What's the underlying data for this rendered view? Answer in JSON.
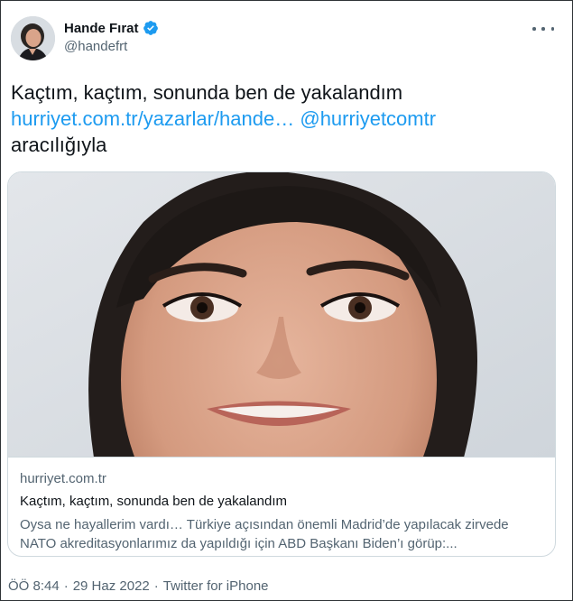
{
  "author": {
    "display_name": "Hande Fırat",
    "handle": "@handefrt",
    "verified": true,
    "avatar_icon": "profile-photo-icon"
  },
  "menu": {
    "icon": "more-dots-icon"
  },
  "tweet": {
    "text_main": "Kaçtım, kaçtım, sonunda ben de yakalandım",
    "link_url": "hurriyet.com.tr/yazarlar/hande…",
    "mention": "@hurriyetcomtr",
    "text_suffix": "aracılığıyla"
  },
  "link_card": {
    "image_icon": "article-photo",
    "domain": "hurriyet.com.tr",
    "title": "Kaçtım, kaçtım, sonunda ben de yakalandım",
    "description": "Oysa ne hayallerim vardı… Türkiye açısından önemli Madrid’de yapılacak zirvede NATO akreditasyonlarımız da yapıldığı için ABD Başkanı Biden’ı görüp:..."
  },
  "footer": {
    "time": "ÖÖ 8:44",
    "separator": "·",
    "date": "29 Haz 2022",
    "separator2": "·",
    "source": "Twitter for iPhone"
  },
  "colors": {
    "link": "#1d9bf0",
    "text": "#0f1419",
    "secondary": "#536471",
    "verified_badge": "#1d9bf0",
    "border": "#cfd9de"
  }
}
